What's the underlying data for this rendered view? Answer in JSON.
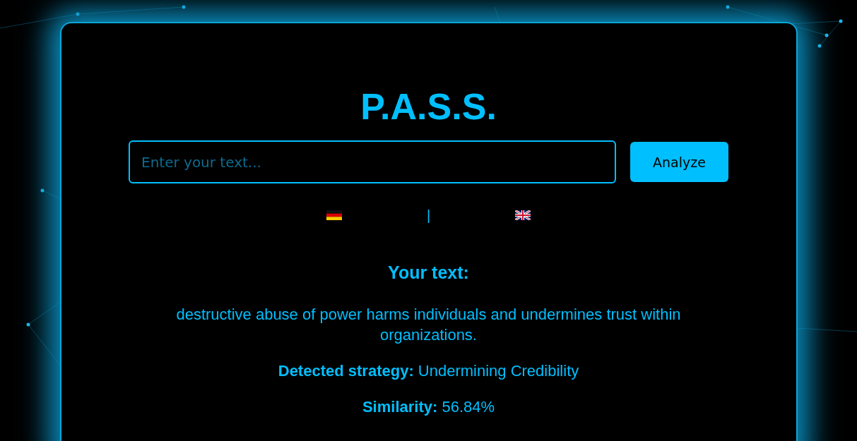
{
  "title": "P.A.S.S.",
  "search": {
    "placeholder": "Enter your text..."
  },
  "analyze_button": "Analyze",
  "languages": {
    "separator": "|",
    "items": [
      {
        "kind": "german",
        "selected": false
      },
      {
        "kind": "english",
        "selected": false
      }
    ]
  },
  "result": {
    "heading": "Your text:",
    "text": "destructive abuse of power harms individuals and undermines trust within organizations.",
    "fields": [
      {
        "label": "Detected strategy:",
        "value": "Undermining Credibility"
      },
      {
        "label": "Similarity:",
        "value": "56.84%"
      }
    ]
  }
}
